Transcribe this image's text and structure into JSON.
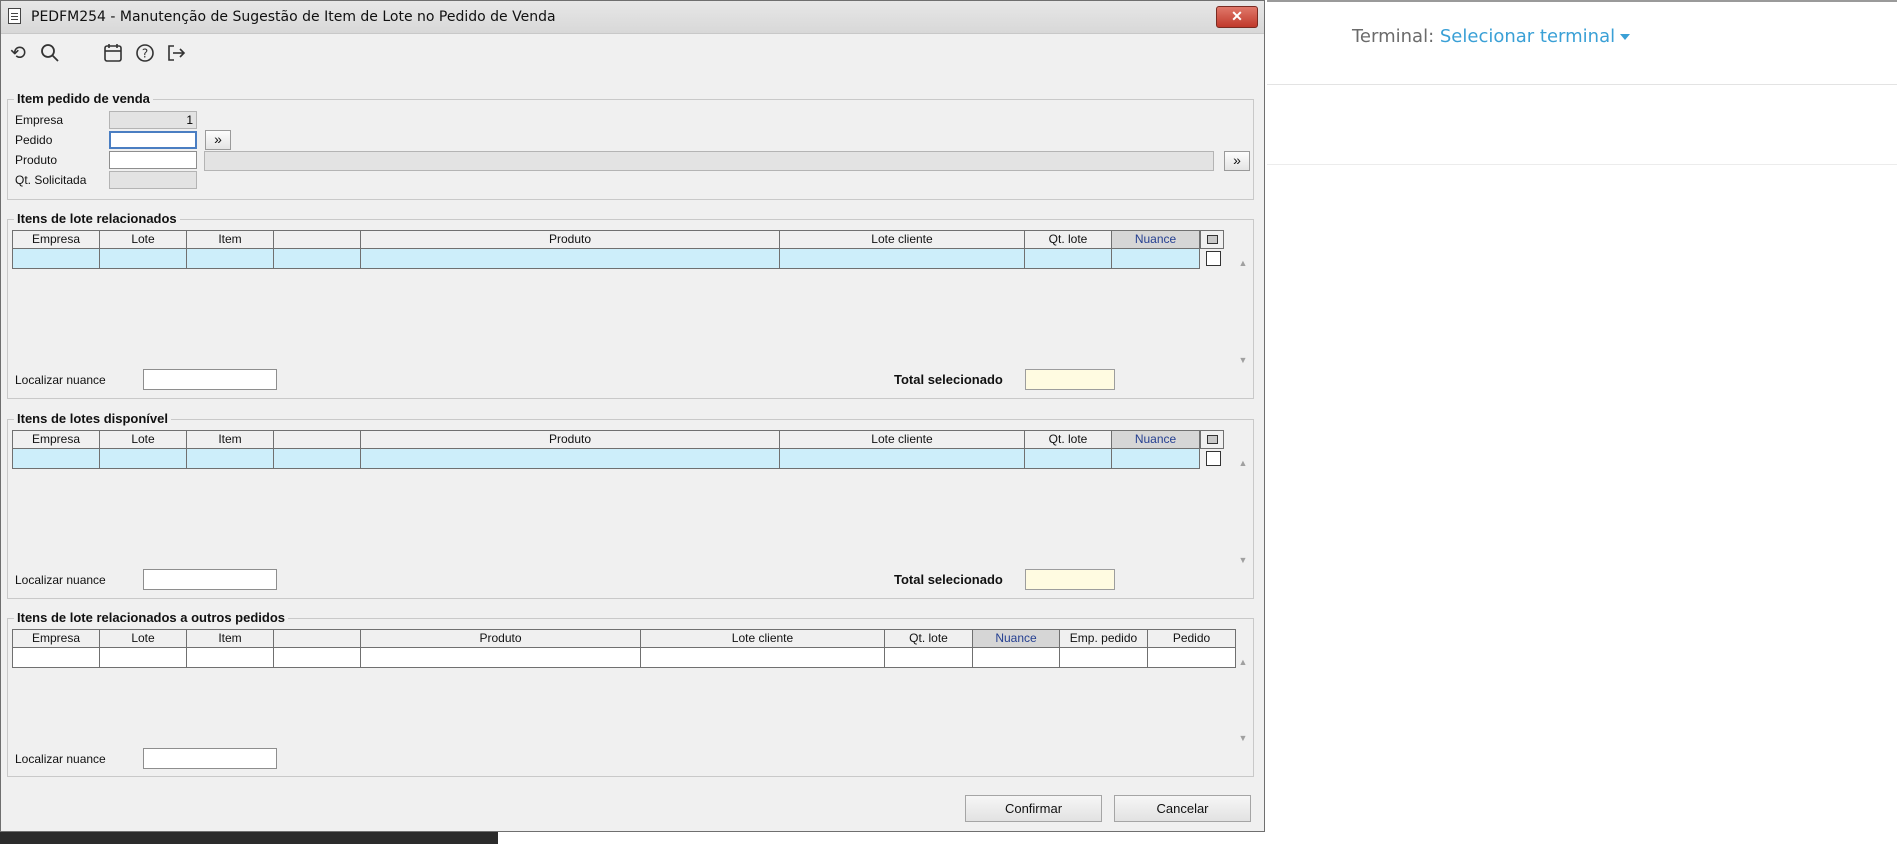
{
  "window": {
    "title": "PEDFM254 - Manutenção de Sugestão de Item de Lote no Pedido de Venda",
    "close_glyph": "✕"
  },
  "toolbar": {
    "icons": [
      "undo-icon",
      "search-icon",
      "calendar-icon",
      "help-icon",
      "exit-icon"
    ]
  },
  "item_pedido": {
    "title": "Item pedido de venda",
    "empresa_label": "Empresa",
    "empresa_value": "1",
    "pedido_label": "Pedido",
    "pedido_value": "",
    "pedido_lookup": "»",
    "produto_label": "Produto",
    "produto_value": "",
    "produto_desc": "",
    "produto_lookup": "»",
    "qt_label": "Qt. Solicitada",
    "qt_value": ""
  },
  "relacionados": {
    "title": "Itens de lote relacionados",
    "columns": [
      "Empresa",
      "Lote",
      "Item",
      "",
      "Produto",
      "Lote cliente",
      "Qt. lote",
      "Nuance"
    ],
    "localizar_label": "Localizar nuance",
    "localizar_value": "",
    "total_label": "Total selecionado",
    "total_value": ""
  },
  "disponivel": {
    "title": "Itens de lotes disponível",
    "columns": [
      "Empresa",
      "Lote",
      "Item",
      "",
      "Produto",
      "Lote cliente",
      "Qt. lote",
      "Nuance"
    ],
    "localizar_label": "Localizar nuance",
    "localizar_value": "",
    "total_label": "Total selecionado",
    "total_value": ""
  },
  "outros": {
    "title": "Itens de lote relacionados a outros pedidos",
    "columns": [
      "Empresa",
      "Lote",
      "Item",
      "",
      "Produto",
      "Lote cliente",
      "Qt. lote",
      "Nuance",
      "Emp. pedido",
      "Pedido"
    ],
    "localizar_label": "Localizar nuance",
    "localizar_value": ""
  },
  "actions": {
    "confirmar": "Confirmar",
    "cancelar": "Cancelar"
  },
  "terminal": {
    "label": "Terminal:",
    "link": "Selecionar terminal"
  }
}
